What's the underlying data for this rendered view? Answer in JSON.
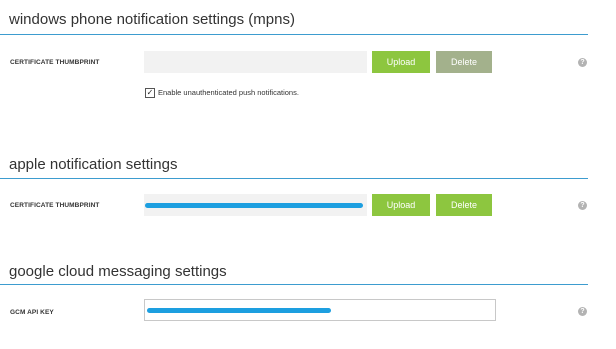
{
  "mpns": {
    "title": "windows phone notification settings (mpns)",
    "cert_label": "CERTIFICATE THUMBPRINT",
    "upload_label": "Upload",
    "delete_label": "Delete",
    "checkbox_checked": true,
    "checkbox_label": "Enable unauthenticated push notifications."
  },
  "apple": {
    "title": "apple notification settings",
    "cert_label": "CERTIFICATE THUMBPRINT",
    "upload_label": "Upload",
    "delete_label": "Delete"
  },
  "gcm": {
    "title": "google cloud messaging settings",
    "api_key_label": "GCM API KEY"
  },
  "icons": {
    "help": "help-icon",
    "help_glyph": "?",
    "check_glyph": "✓"
  },
  "colors": {
    "accent_rule": "#3d9ccf",
    "button_green": "#8dc63f",
    "button_disabled": "#a3b18c",
    "redaction": "#1d9fe0"
  }
}
